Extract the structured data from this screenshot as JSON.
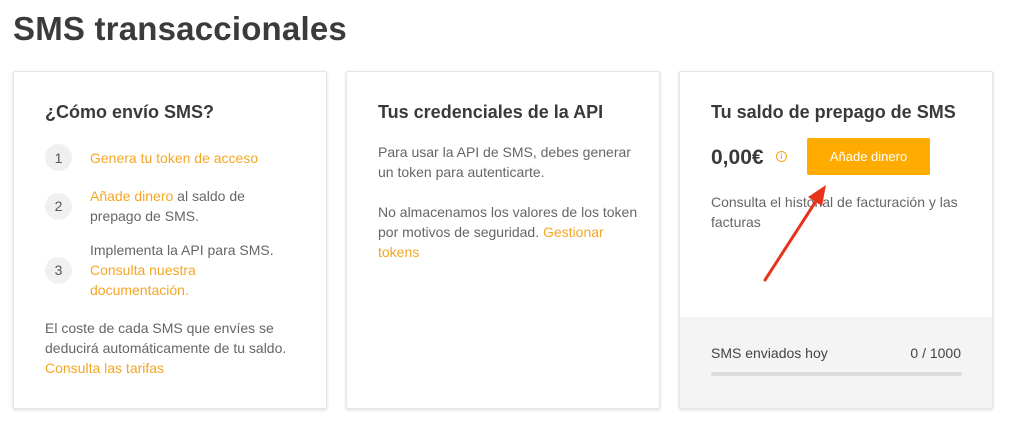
{
  "page": {
    "title": "SMS transaccionales"
  },
  "how_to": {
    "title": "¿Cómo envío SMS?",
    "steps": [
      {
        "num": "1",
        "link": "Genera tu token de acceso",
        "text": ""
      },
      {
        "num": "2",
        "link": "Añade dinero",
        "text": " al saldo de prepago de SMS."
      },
      {
        "num": "3",
        "text": "Implementa la API para SMS. ",
        "link": "Consulta nuestra documentación."
      }
    ],
    "cost_text": "El coste de cada SMS que envíes se deducirá automáticamente de tu saldo. ",
    "cost_link": "Consulta las tarifas"
  },
  "api": {
    "title": "Tus credenciales de la API",
    "p1": "Para usar la API de SMS, debes generar un token para autenticarte.",
    "p2": "No almacenamos los valores de los token por motivos de seguridad. ",
    "p2_link": "Gestionar tokens"
  },
  "balance": {
    "title": "Tu saldo de prepago de SMS",
    "amount": "0,00€",
    "info_icon": "info-icon",
    "add_button": "Añade dinero",
    "history_link": "Consulta el historial de facturación y las facturas",
    "sent_label": "SMS enviados hoy",
    "sent_count": "0 / 1000",
    "sent_fraction": 0
  },
  "colors": {
    "accent": "#f5a623",
    "button": "#ffab00",
    "annotation_arrow": "#e8331c"
  }
}
